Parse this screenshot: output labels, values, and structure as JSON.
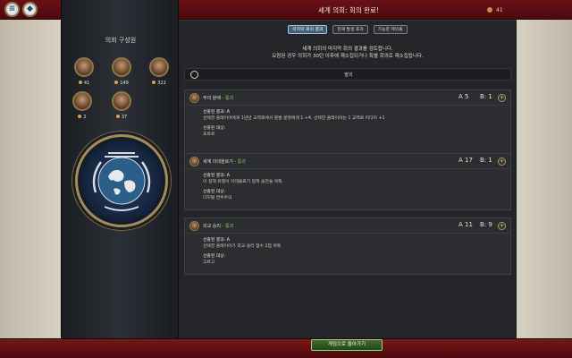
{
  "header": {
    "title": "세계 의회: 회의 완료!",
    "count": "41"
  },
  "tabs": [
    {
      "label": "마지막 회의 결과",
      "active": true
    },
    {
      "label": "현재 발생 효과",
      "active": false
    },
    {
      "label": "가능한 제의들",
      "active": false
    }
  ],
  "summary": {
    "line1": "세계 의회의 마지막 회의 결과를 검토합니다.",
    "line2": "요청된 경우 의회가 30턴 이후에 재소집되거나 특별 회의로 재소집됩니다."
  },
  "council": {
    "title": "의회 구성원",
    "members": [
      {
        "votes": "41"
      },
      {
        "votes": "149"
      },
      {
        "votes": "322"
      },
      {
        "votes": "2"
      },
      {
        "votes": "37"
      }
    ]
  },
  "section_header": "발의",
  "resolutions": [
    {
      "name": "부의 분배",
      "status": "통과",
      "vote_a": "A 5",
      "vote_b": "B: 1",
      "result_label": "선출된 결과: A",
      "result_text": "선택한 플레이어에게 1년년 교역로에서 출발 문명에게 1 +4, 선택한 플레이어는 1 교역로 피더지 +1",
      "choice_label": "선출된 대상:",
      "choice_value": "포르르"
    },
    {
      "name": "세계 이데올로기",
      "status": "통과",
      "vote_a": "A 17",
      "vote_b": "B: 1",
      "result_label": "선출된 결과: A",
      "result_text": "이 정책 유형이 이데올로기 정책 승전을 획득",
      "choice_label": "선출된 대상:",
      "choice_value": "다지털 연주주의"
    },
    {
      "name": "외교 승리",
      "status": "통과",
      "vote_a": "A 11",
      "vote_b": "B: 9",
      "result_label": "선출된 결과: A",
      "result_text": "선택한 플레이어가 외교 승리 점수 2점 획득",
      "choice_label": "선출된 대상:",
      "choice_value": "고르고"
    }
  ],
  "footer": {
    "return_label": "게임으로 돌아가기"
  },
  "colors": {
    "accent_red": "#6b1115",
    "passed_green": "#7fc35a",
    "button_green": "#3f6d2b"
  }
}
